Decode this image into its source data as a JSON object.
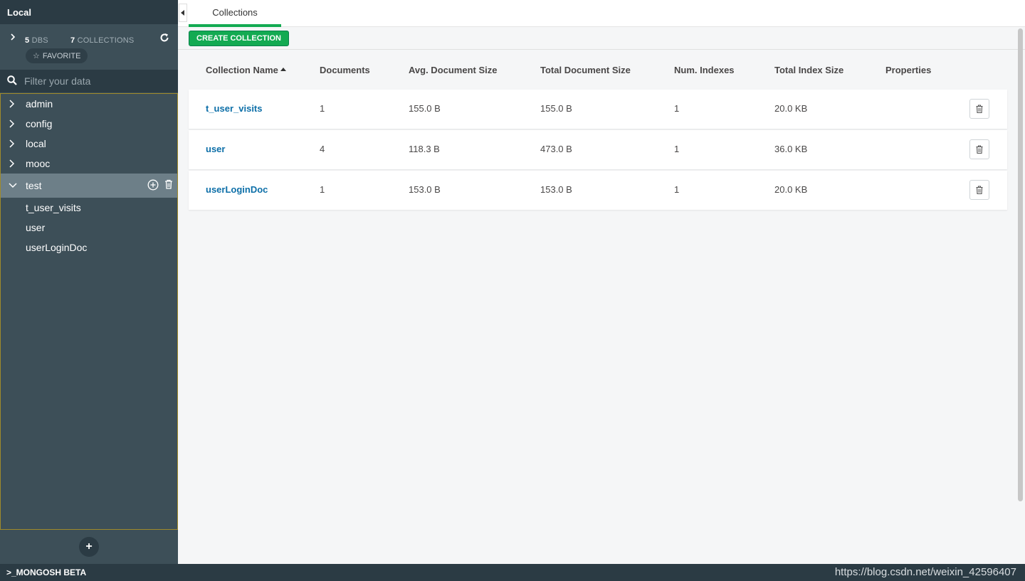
{
  "sidebar": {
    "title": "Local",
    "dbs_count": "5",
    "dbs_label": "DBS",
    "collections_count": "7",
    "collections_label": "COLLECTIONS",
    "favorite_label": "FAVORITE",
    "filter_placeholder": "Filter your data",
    "databases": [
      {
        "name": "admin"
      },
      {
        "name": "config"
      },
      {
        "name": "local"
      },
      {
        "name": "mooc"
      },
      {
        "name": "test"
      }
    ],
    "test_collections": [
      "t_user_visits",
      "user",
      "userLoginDoc"
    ]
  },
  "main": {
    "tab_label": "Collections",
    "create_button": "CREATE COLLECTION",
    "columns": {
      "name": "Collection Name",
      "documents": "Documents",
      "avg_size": "Avg. Document Size",
      "total_size": "Total Document Size",
      "num_indexes": "Num. Indexes",
      "index_size": "Total Index Size",
      "properties": "Properties"
    },
    "rows": [
      {
        "name": "t_user_visits",
        "documents": "1",
        "avg_size": "155.0 B",
        "total_size": "155.0 B",
        "num_indexes": "1",
        "index_size": "20.0 KB"
      },
      {
        "name": "user",
        "documents": "4",
        "avg_size": "118.3 B",
        "total_size": "473.0 B",
        "num_indexes": "1",
        "index_size": "36.0 KB"
      },
      {
        "name": "userLoginDoc",
        "documents": "1",
        "avg_size": "153.0 B",
        "total_size": "153.0 B",
        "num_indexes": "1",
        "index_size": "20.0 KB"
      }
    ]
  },
  "bottombar": {
    "shell_label": ">_MONGOSH BETA",
    "watermark": "https://blog.csdn.net/weixin_42596407"
  },
  "colors": {
    "sidebar_bg": "#3d4f58",
    "sidebar_dark": "#2b3b44",
    "accent_green": "#13aa52",
    "link_blue": "#0d6fa8"
  }
}
